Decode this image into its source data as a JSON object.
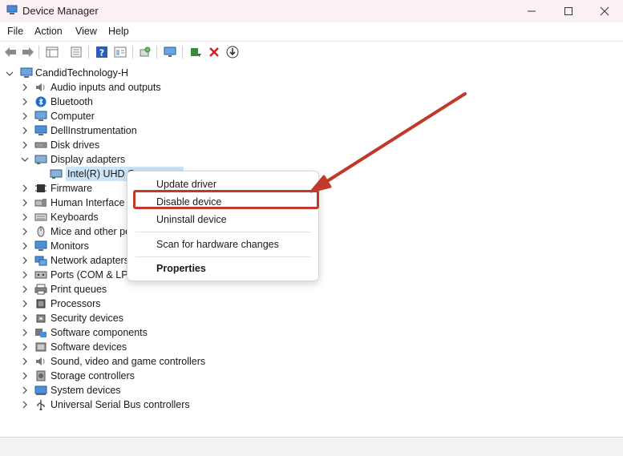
{
  "window": {
    "title": "Device Manager",
    "minimize_icon": "minimize-icon",
    "maximize_icon": "maximize-icon",
    "close_icon": "close-icon"
  },
  "menu": [
    "File",
    "Action",
    "View",
    "Help"
  ],
  "toolbar": [
    "back-arrow-icon",
    "forward-arrow-icon",
    "properties-sheet-icon",
    "list-icon",
    "help-icon",
    "view-icon",
    "scan-icon",
    "monitor-icon",
    "update-driver-icon",
    "uninstall-x-icon",
    "download-icon"
  ],
  "tree": {
    "root": "CandidTechnology-H",
    "items": [
      {
        "label": "Audio inputs and outputs",
        "icon": "speaker-icon"
      },
      {
        "label": "Bluetooth",
        "icon": "bluetooth-icon"
      },
      {
        "label": "Computer",
        "icon": "computer-icon"
      },
      {
        "label": "DellInstrumentation",
        "icon": "monitor-icon"
      },
      {
        "label": "Disk drives",
        "icon": "disk-icon"
      },
      {
        "label": "Display adapters",
        "icon": "display-adapter-icon",
        "expanded": true
      },
      {
        "label": "Intel(R) UHD G",
        "icon": "display-adapter-icon",
        "child": true
      },
      {
        "label": "Firmware",
        "icon": "chip-icon"
      },
      {
        "label": "Human Interface I",
        "icon": "hid-icon"
      },
      {
        "label": "Keyboards",
        "icon": "keyboard-icon"
      },
      {
        "label": "Mice and other po",
        "icon": "mouse-icon"
      },
      {
        "label": "Monitors",
        "icon": "monitor-icon"
      },
      {
        "label": "Network adapters",
        "icon": "network-icon"
      },
      {
        "label": "Ports (COM & LPT",
        "icon": "port-icon"
      },
      {
        "label": "Print queues",
        "icon": "printer-icon"
      },
      {
        "label": "Processors",
        "icon": "processor-icon"
      },
      {
        "label": "Security devices",
        "icon": "security-icon"
      },
      {
        "label": "Software components",
        "icon": "software-component-icon"
      },
      {
        "label": "Software devices",
        "icon": "software-device-icon"
      },
      {
        "label": "Sound, video and game controllers",
        "icon": "speaker-icon"
      },
      {
        "label": "Storage controllers",
        "icon": "storage-icon"
      },
      {
        "label": "System devices",
        "icon": "system-icon"
      },
      {
        "label": "Universal Serial Bus controllers",
        "icon": "usb-icon"
      }
    ]
  },
  "context_menu": {
    "update": "Update driver",
    "disable": "Disable device",
    "uninstall": "Uninstall device",
    "scan": "Scan for hardware changes",
    "properties": "Properties"
  },
  "accent": {
    "arrow": "#c0392b",
    "selection": "#cce4f7"
  }
}
